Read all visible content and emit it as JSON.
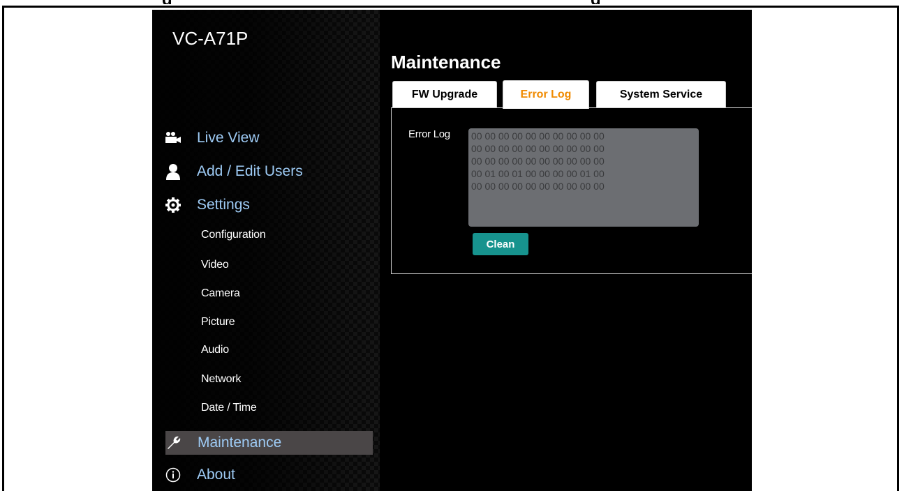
{
  "doc_heading_fragment": "g                                                    g",
  "app": {
    "model": "VC-A71P"
  },
  "nav": {
    "live_view": "Live View",
    "add_edit_users": "Add / Edit Users",
    "settings": "Settings",
    "maintenance": "Maintenance",
    "about": "About"
  },
  "settings_items": [
    "Configuration",
    "Video",
    "Camera",
    "Picture",
    "Audio",
    "Network",
    "Date / Time"
  ],
  "page": {
    "title": "Maintenance",
    "tabs": [
      "FW Upgrade",
      "Error Log",
      "System Service"
    ],
    "active_tab": "Error Log"
  },
  "error_log": {
    "label": "Error Log",
    "content": "00 00 00 00 00 00 00 00 00 00\n00 00 00 00 00 00 00 00 00 00\n00 00 00 00 00 00 00 00 00 00\n00 01 00 01 00 00 00 00 01 00\n00 00 00 00 00 00 00 00 00 00",
    "clean_button": "Clean"
  },
  "colors": {
    "nav_link": "#9ecbf5",
    "active_tab_text": "#f08a00",
    "clean_button": "#17938e",
    "log_box": "#6c6e72",
    "active_nav_bg": "#4a4647"
  }
}
